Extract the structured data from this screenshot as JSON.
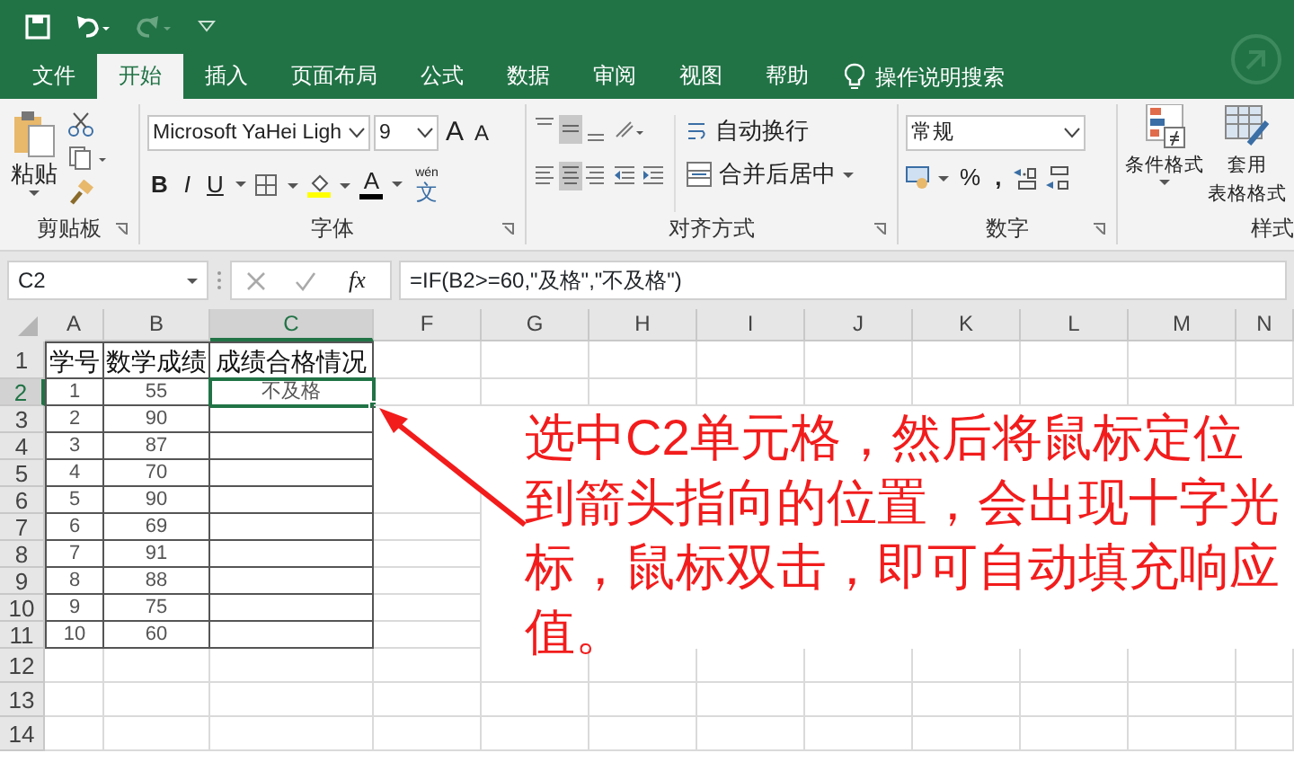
{
  "tabs": [
    {
      "label": "文件",
      "selected": false
    },
    {
      "label": "开始",
      "selected": true
    },
    {
      "label": "插入",
      "selected": false
    },
    {
      "label": "页面布局",
      "selected": false
    },
    {
      "label": "公式",
      "selected": false
    },
    {
      "label": "数据",
      "selected": false
    },
    {
      "label": "审阅",
      "selected": false
    },
    {
      "label": "视图",
      "selected": false
    },
    {
      "label": "帮助",
      "selected": false
    }
  ],
  "tell_me": {
    "label": "操作说明搜索"
  },
  "ribbon": {
    "clipboard": {
      "paste": "粘贴",
      "label": "剪贴板"
    },
    "font": {
      "name": "Microsoft YaHei Ligh",
      "size": "9",
      "grow": "A",
      "shrink": "A",
      "bold": "B",
      "italic": "I",
      "underline": "U",
      "font_color": "A",
      "phonetic_small": "wén",
      "phonetic": "文",
      "label": "字体"
    },
    "alignment": {
      "wrap": "自动换行",
      "merge": "合并后居中",
      "label": "对齐方式"
    },
    "number": {
      "format": "常规",
      "percent": "%",
      "comma": ",",
      "label": "数字"
    },
    "styles": {
      "conditional": "条件格式",
      "table_format_lines": [
        "套用",
        "表格格式"
      ],
      "label": "样式"
    }
  },
  "formula_bar": {
    "name_box": "C2",
    "fx": "fx",
    "formula": "=IF(B2>=60,\"及格\",\"不及格\")"
  },
  "columns": [
    {
      "label": "A",
      "selected": false
    },
    {
      "label": "B",
      "selected": false
    },
    {
      "label": "C",
      "selected": true
    },
    {
      "label": "F",
      "selected": false
    },
    {
      "label": "G",
      "selected": false
    },
    {
      "label": "H",
      "selected": false
    },
    {
      "label": "I",
      "selected": false
    },
    {
      "label": "J",
      "selected": false
    },
    {
      "label": "K",
      "selected": false
    },
    {
      "label": "L",
      "selected": false
    },
    {
      "label": "M",
      "selected": false
    },
    {
      "label": "N",
      "selected": false
    }
  ],
  "rows": [
    {
      "header": "1",
      "kind": "title",
      "selected": false,
      "cells": [
        {
          "text": "学号",
          "selected": false
        },
        {
          "text": "数学成绩",
          "selected": false
        },
        {
          "text": "成绩合格情况",
          "selected": false
        }
      ]
    },
    {
      "header": "2",
      "kind": "data",
      "selected": true,
      "cells": [
        {
          "text": "1",
          "selected": false
        },
        {
          "text": "55",
          "selected": false
        },
        {
          "text": "不及格",
          "selected": true
        }
      ]
    },
    {
      "header": "3",
      "kind": "data",
      "selected": false,
      "cells": [
        {
          "text": "2",
          "selected": false
        },
        {
          "text": "90",
          "selected": false
        }
      ]
    },
    {
      "header": "4",
      "kind": "data",
      "selected": false,
      "cells": [
        {
          "text": "3",
          "selected": false
        },
        {
          "text": "87",
          "selected": false
        }
      ]
    },
    {
      "header": "5",
      "kind": "data",
      "selected": false,
      "cells": [
        {
          "text": "4",
          "selected": false
        },
        {
          "text": "70",
          "selected": false
        }
      ]
    },
    {
      "header": "6",
      "kind": "data",
      "selected": false,
      "cells": [
        {
          "text": "5",
          "selected": false
        },
        {
          "text": "90",
          "selected": false
        }
      ]
    },
    {
      "header": "7",
      "kind": "data",
      "selected": false,
      "cells": [
        {
          "text": "6",
          "selected": false
        },
        {
          "text": "69",
          "selected": false
        }
      ]
    },
    {
      "header": "8",
      "kind": "data",
      "selected": false,
      "cells": [
        {
          "text": "7",
          "selected": false
        },
        {
          "text": "91",
          "selected": false
        }
      ]
    },
    {
      "header": "9",
      "kind": "data",
      "selected": false,
      "cells": [
        {
          "text": "8",
          "selected": false
        },
        {
          "text": "88",
          "selected": false
        }
      ]
    },
    {
      "header": "10",
      "kind": "data",
      "selected": false,
      "cells": [
        {
          "text": "9",
          "selected": false
        },
        {
          "text": "75",
          "selected": false
        }
      ]
    },
    {
      "header": "11",
      "kind": "data",
      "selected": false,
      "cells": [
        {
          "text": "10",
          "selected": false
        },
        {
          "text": "60",
          "selected": false
        }
      ]
    },
    {
      "header": "12",
      "kind": "empty",
      "selected": false
    },
    {
      "header": "13",
      "kind": "empty",
      "selected": false
    },
    {
      "header": "14",
      "kind": "empty",
      "selected": false
    }
  ],
  "annotation": {
    "text": "选中C2单元格，然后将鼠标定位到箭头指向的位置，会出现十字光标，鼠标双击，即可自动填充响应值。"
  }
}
